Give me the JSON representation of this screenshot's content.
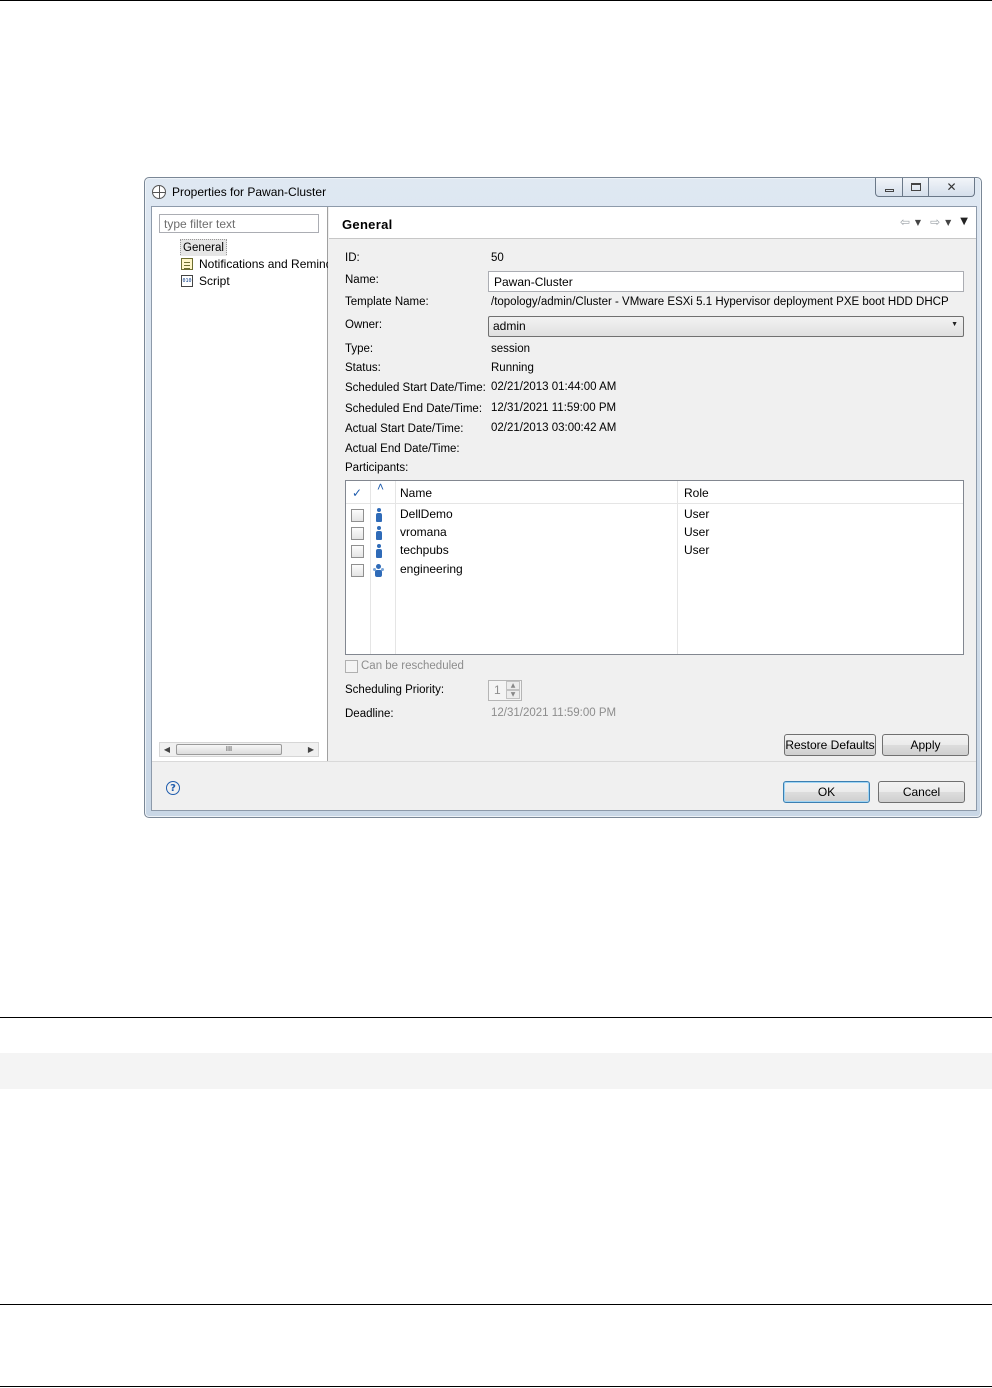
{
  "window": {
    "title": "Properties for Pawan-Cluster"
  },
  "left_pane": {
    "filter_placeholder": "type filter text",
    "tree_items": [
      {
        "label": "General",
        "icon": "general-icon",
        "selected": true
      },
      {
        "label": "Notifications and Reminders",
        "icon": "notifications-icon"
      },
      {
        "label": "Script",
        "icon": "script-icon"
      }
    ],
    "hscroll_thumb_glyph": "III"
  },
  "page": {
    "title": "General",
    "fields": {
      "id_label": "ID:",
      "id_value": "50",
      "name_label": "Name:",
      "name_value": "Pawan-Cluster",
      "template_label": "Template Name:",
      "template_value": "/topology/admin/Cluster - VMware ESXi 5.1 Hypervisor deployment PXE boot HDD DHCP",
      "owner_label": "Owner:",
      "owner_value": "admin",
      "type_label": "Type:",
      "type_value": "session",
      "status_label": "Status:",
      "status_value": "Running",
      "sched_start_label": "Scheduled Start Date/Time:",
      "sched_start_value": "02/21/2013 01:44:00 AM",
      "sched_end_label": "Scheduled End Date/Time:",
      "sched_end_value": "12/31/2021 11:59:00 PM",
      "actual_start_label": "Actual Start Date/Time:",
      "actual_start_value": "02/21/2013 03:00:42 AM",
      "actual_end_label": "Actual End Date/Time:",
      "participants_label": "Participants:"
    },
    "participants": {
      "headers": {
        "check": "✓",
        "sort": "˄",
        "name": "Name",
        "role": "Role"
      },
      "rows": [
        {
          "name": "DellDemo",
          "role": "User",
          "icon": "user-icon"
        },
        {
          "name": "vromana",
          "role": "User",
          "icon": "user-icon"
        },
        {
          "name": "techpubs",
          "role": "User",
          "icon": "user-icon"
        },
        {
          "name": "engineering",
          "role": "",
          "icon": "group-icon"
        }
      ]
    },
    "can_be_rescheduled_label": "Can be rescheduled",
    "scheduling_priority_label": "Scheduling Priority:",
    "scheduling_priority_value": "1",
    "deadline_label": "Deadline:",
    "deadline_value": "12/31/2021 11:59:00 PM",
    "restore_defaults_label": "Restore Defaults",
    "apply_label": "Apply"
  },
  "dialog_buttons": {
    "ok_label": "OK",
    "cancel_label": "Cancel"
  }
}
